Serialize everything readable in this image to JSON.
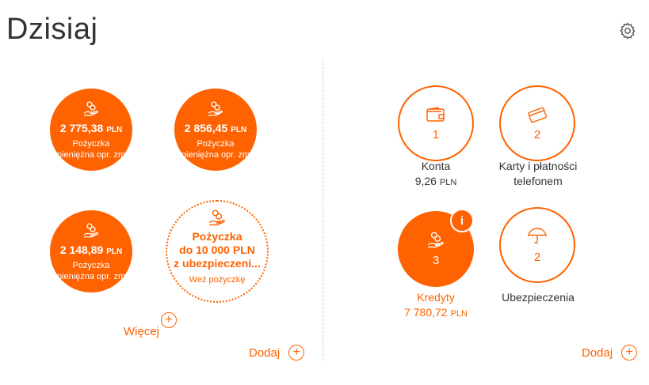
{
  "header": {
    "title": "Dzisiaj"
  },
  "loans": [
    {
      "amount": "2 775,38",
      "currency": "PLN",
      "desc1": "Pożyczka",
      "desc2": "pieniężna opr. zm"
    },
    {
      "amount": "2 856,45",
      "currency": "PLN",
      "desc1": "Pożyczka",
      "desc2": "pieniężna opr. zm"
    },
    {
      "amount": "2 148,89",
      "currency": "PLN",
      "desc1": "Pożyczka",
      "desc2": "pieniężna opr. zm"
    }
  ],
  "offer": {
    "line1": "Pożyczka",
    "line2": "do 10 000 PLN",
    "line3": "z ubezpieczeni...",
    "cta": "Weź pożyczkę"
  },
  "left": {
    "more_label": "Więcej",
    "add_label": "Dodaj"
  },
  "products": [
    {
      "count": "1",
      "name": "Konta",
      "value": "9,26",
      "currency": "PLN"
    },
    {
      "count": "2",
      "name": "Karty i płatności",
      "name2": "telefonem"
    },
    {
      "count": "3",
      "name": "Kredyty",
      "value": "7 780,72",
      "currency": "PLN",
      "badge": "i"
    },
    {
      "count": "2",
      "name": "Ubezpieczenia"
    }
  ],
  "right": {
    "add_label": "Dodaj"
  },
  "colors": {
    "accent": "#ff6200",
    "text": "#333333"
  },
  "icons": {
    "settings": "gear-icon",
    "loan": "coin-hand-icon",
    "wallet": "wallet-icon",
    "card": "card-icon",
    "umbrella": "umbrella-icon"
  }
}
